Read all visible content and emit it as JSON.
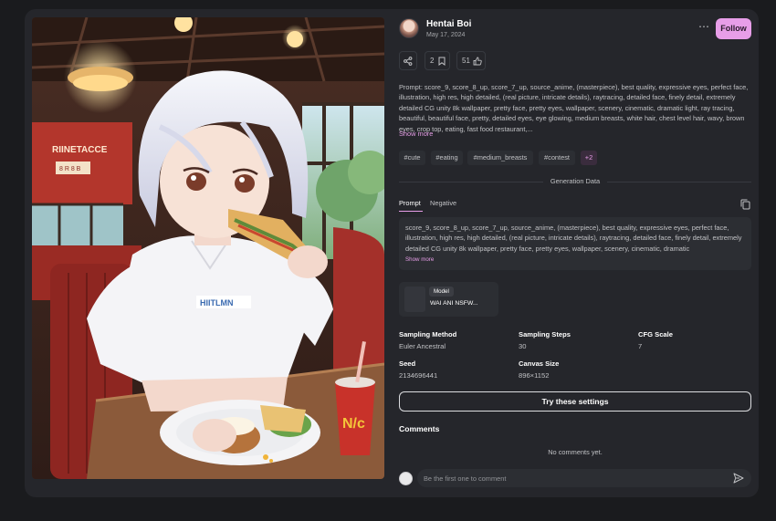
{
  "image": {
    "alt": "Anime girl with white hair eating a sandwich",
    "shirt_text": "HIITLMN",
    "sign_text_1": "RIINETACCE",
    "sign_text_2": "8 R 8 B",
    "cup_text": "N/c"
  },
  "author": {
    "name": "Hentai Boi",
    "date": "May 17, 2024",
    "avatar_icon": "avatar-icon"
  },
  "header": {
    "more_label": "⋯",
    "follow_label": "Follow",
    "follow_color": "#e79ee8"
  },
  "actions": {
    "share_icon": "share-icon",
    "bookmark_count": "2",
    "bookmark_icon": "bookmark-icon",
    "like_count": "51",
    "like_icon": "thumbs-up-icon"
  },
  "prompt": {
    "text": "Prompt: score_9, score_8_up, score_7_up, source_anime, (masterpiece), best quality, expressive eyes, perfect face, illustration, high res, high detailed, (real picture, intricate details), raytracing, detailed face, finely detail, extremely detailed CG unity 8k wallpaper, pretty face, pretty eyes, wallpaper, scenery, cinematic, dramatic light, ray tracing, beautiful, beautiful face, pretty, detailed eyes, eye glowing, medium breasts, white hair, chest level hair, wavy, brown eyes, crop top, eating, fast food restaurant,...",
    "show_more": "Show more"
  },
  "tags": [
    {
      "label": "#cute"
    },
    {
      "label": "#eating"
    },
    {
      "label": "#medium_breasts"
    },
    {
      "label": "#contest"
    },
    {
      "label": "+2"
    }
  ],
  "generation": {
    "section_title": "Generation Data",
    "tabs": [
      {
        "label": "Prompt"
      },
      {
        "label": "Negative"
      }
    ],
    "copy_icon": "copy-icon",
    "prompt_text": "score_9, score_8_up, score_7_up, source_anime, (masterpiece), best quality, expressive eyes, perfect face, illustration, high res, high detailed, (real picture, intricate details), raytracing, detailed face, finely detail, extremely detailed CG unity 8k wallpaper, pretty face, pretty eyes, wallpaper, scenery, cinematic, dramatic",
    "show_more": "Show more",
    "model": {
      "badge": "Model",
      "name": "WAI ANI NSFW..."
    },
    "specs": [
      {
        "label": "Sampling Method",
        "value": "Euler Ancestral"
      },
      {
        "label": "Sampling Steps",
        "value": "30"
      },
      {
        "label": "CFG Scale",
        "value": "7"
      },
      {
        "label": "Seed",
        "value": "2134696441"
      },
      {
        "label": "Canvas Size",
        "value": "896×1152"
      }
    ],
    "try_label": "Try these settings"
  },
  "comments": {
    "title": "Comments",
    "empty": "No comments yet.",
    "placeholder": "Be the first one to comment",
    "send_icon": "send-icon"
  }
}
